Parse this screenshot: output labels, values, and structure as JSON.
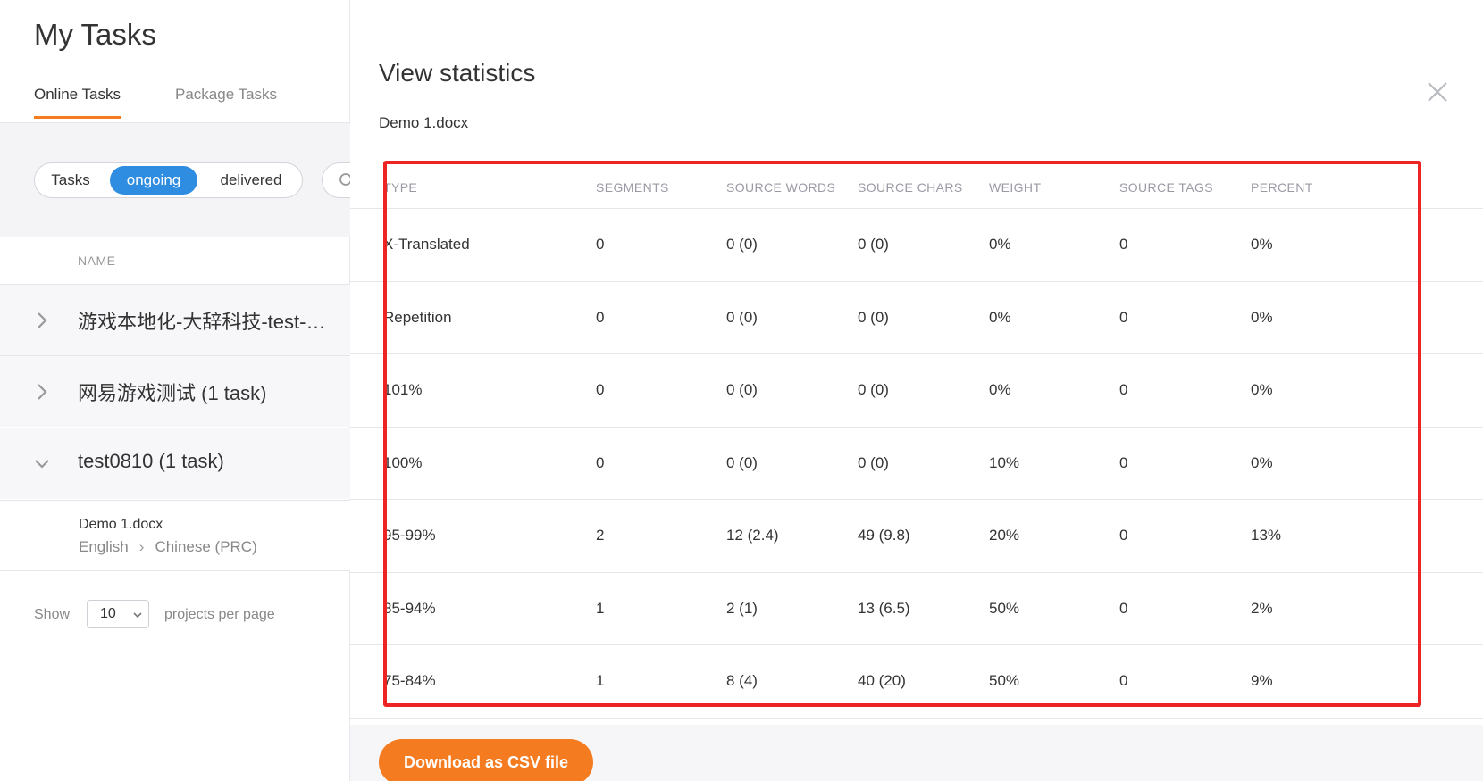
{
  "page": {
    "title": "My Tasks",
    "tabs": [
      {
        "label": "Online Tasks",
        "active": true
      },
      {
        "label": "Package Tasks",
        "active": false
      }
    ]
  },
  "filter": {
    "options": [
      "Tasks",
      "ongoing",
      "delivered"
    ],
    "selected": "ongoing"
  },
  "list": {
    "header": "NAME",
    "projects": [
      {
        "title": "游戏本地化-大辞科技-test-…",
        "expanded": false
      },
      {
        "title": "网易游戏测试  (1 task)",
        "expanded": false
      },
      {
        "title": "test0810  (1 task)",
        "expanded": true
      }
    ],
    "task": {
      "name": "Demo 1.docx",
      "source_lang": "English",
      "target_lang": "Chinese (PRC)"
    }
  },
  "pager": {
    "show_label": "Show",
    "per_page": "10",
    "per_page_label": "projects per page"
  },
  "modal": {
    "title": "View statistics",
    "file_name": "Demo 1.docx",
    "download_label": "Download as CSV file",
    "columns": [
      "TYPE",
      "SEGMENTS",
      "SOURCE WORDS",
      "SOURCE CHARS",
      "WEIGHT",
      "SOURCE TAGS",
      "PERCENT"
    ],
    "rows": [
      [
        "X-Translated",
        "0",
        "0 (0)",
        "0 (0)",
        "0%",
        "0",
        "0%"
      ],
      [
        "Repetition",
        "0",
        "0 (0)",
        "0 (0)",
        "0%",
        "0",
        "0%"
      ],
      [
        "101%",
        "0",
        "0 (0)",
        "0 (0)",
        "0%",
        "0",
        "0%"
      ],
      [
        "100%",
        "0",
        "0 (0)",
        "0 (0)",
        "10%",
        "0",
        "0%"
      ],
      [
        "95-99%",
        "2",
        "12 (2.4)",
        "49 (9.8)",
        "20%",
        "0",
        "13%"
      ],
      [
        "85-94%",
        "1",
        "2 (1)",
        "13 (6.5)",
        "50%",
        "0",
        "2%"
      ],
      [
        "75-84%",
        "1",
        "8 (4)",
        "40 (20)",
        "50%",
        "0",
        "9%"
      ]
    ]
  },
  "colors": {
    "accent_orange": "#f47b20",
    "toggle_blue": "#2e8de0",
    "highlight_red": "#ee2323"
  },
  "icons": [
    "search-icon",
    "chevron-right-icon",
    "chevron-down-icon",
    "close-icon",
    "select-chevron-icon"
  ]
}
